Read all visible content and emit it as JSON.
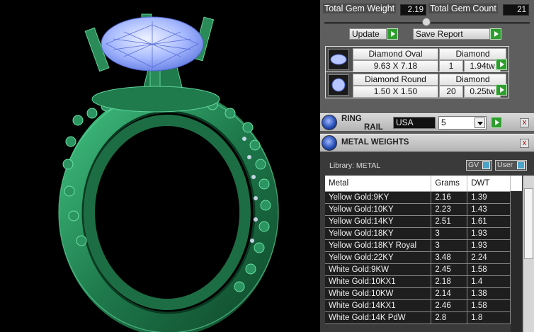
{
  "summary": {
    "total_gem_weight_label": "Total Gem Weight",
    "total_gem_weight_value": "2.19",
    "total_gem_count_label": "Total Gem Count",
    "total_gem_count_value": "21"
  },
  "actions": {
    "update_label": "Update",
    "save_report_label": "Save Report"
  },
  "stones": [
    {
      "name": "Diamond Oval",
      "material": "Diamond",
      "size": "9.63 X 7.18",
      "count": "1",
      "weight": "1.94tw"
    },
    {
      "name": "Diamond Round",
      "material": "Diamond",
      "size": "1.50 X 1.50",
      "count": "20",
      "weight": "0.25tw"
    }
  ],
  "ring_rail": {
    "title_line1": "RING",
    "title_line2": "RAIL",
    "country": "USA",
    "size": "5",
    "close": "x"
  },
  "metal_weights": {
    "title": "METAL WEIGHTS",
    "close": "x",
    "library_label": "Library: METAL",
    "toggle_gv": "GV",
    "toggle_user": "User",
    "headers": [
      "Metal",
      "Grams",
      "DWT"
    ],
    "rows": [
      [
        "Yellow Gold:9KY",
        "2.16",
        "1.39"
      ],
      [
        "Yellow Gold:10KY",
        "2.23",
        "1.43"
      ],
      [
        "Yellow Gold:14KY",
        "2.51",
        "1.61"
      ],
      [
        "Yellow Gold:18KY",
        "3",
        "1.93"
      ],
      [
        "Yellow Gold:18KY Royal",
        "3",
        "1.93"
      ],
      [
        "Yellow Gold:22KY",
        "3.48",
        "2.24"
      ],
      [
        "White Gold:9KW",
        "2.45",
        "1.58"
      ],
      [
        "White Gold:10KX1",
        "2.18",
        "1.4"
      ],
      [
        "White Gold:10KW",
        "2.14",
        "1.38"
      ],
      [
        "White Gold:14KX1",
        "2.46",
        "1.58"
      ],
      [
        "White Gold:14K PdW",
        "2.8",
        "1.8"
      ]
    ]
  },
  "colors": {
    "ring_metal": "#2a8a58",
    "ring_edge": "#5fd39a",
    "gem": "#b8c8ff",
    "go_button": "#2e9e2e"
  }
}
